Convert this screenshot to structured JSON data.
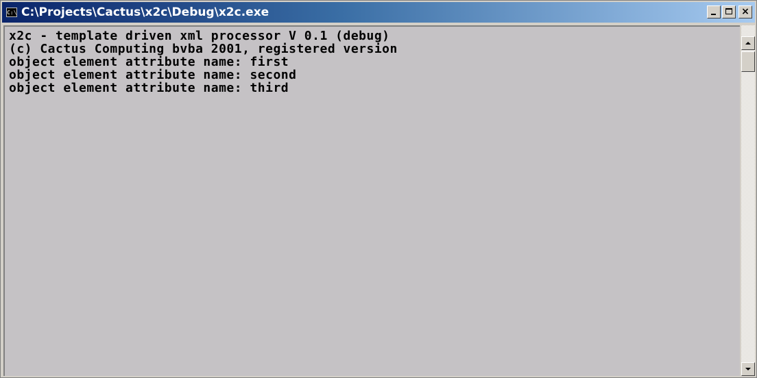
{
  "window": {
    "title": "C:\\Projects\\Cactus\\x2c\\Debug\\x2c.exe",
    "icon_text": "C:\\",
    "close_glyph": "×"
  },
  "console": {
    "lines": [
      "x2c - template driven xml processor V 0.1 (debug)",
      "(c) Cactus Computing bvba 2001, registered version",
      "object element attribute name: first",
      "object element attribute name: second",
      "object element attribute name: third"
    ],
    "background": "#c5c2c5",
    "text_color": "#000000"
  },
  "colors": {
    "titlebar_start": "#0a246a",
    "titlebar_end": "#a6caf0",
    "chrome": "#d4d0c8"
  },
  "icons": {
    "app": "console-app-icon",
    "minimize": "minimize-icon",
    "maximize": "maximize-icon",
    "close": "close-icon",
    "scroll_up": "arrow-up-icon",
    "scroll_down": "arrow-down-icon"
  }
}
